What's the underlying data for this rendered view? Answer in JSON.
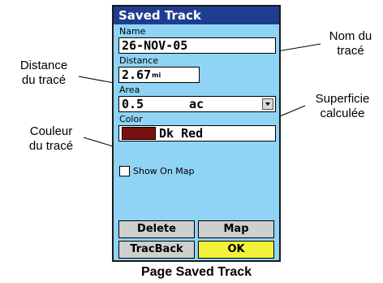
{
  "screen": {
    "title": "Saved Track",
    "name_label": "Name",
    "name_value": "26-NOV-05",
    "distance_label": "Distance",
    "distance_value": "2.67",
    "distance_unit": "mi",
    "area_label": "Area",
    "area_value": "0.5",
    "area_unit": "ac",
    "color_label": "Color",
    "color_value": "Dk Red",
    "color_swatch": "#7a0f0f",
    "show_on_map_label": "Show On Map",
    "show_on_map_checked": false,
    "buttons": {
      "delete": "Delete",
      "map": "Map",
      "tracback": "TracBack",
      "ok": "OK"
    }
  },
  "callouts": {
    "name": [
      "Nom du",
      "tracé"
    ],
    "distance": [
      "Distance",
      "du tracé"
    ],
    "area": [
      "Superficie",
      "calculée"
    ],
    "color": [
      "Couleur",
      "du tracé"
    ]
  },
  "caption": "Page Saved Track",
  "colors": {
    "screen_bg": "#8fd3f5",
    "title_bar": "#1f3d8f",
    "ok_button": "#f2f23a",
    "button": "#cfcfcf"
  }
}
